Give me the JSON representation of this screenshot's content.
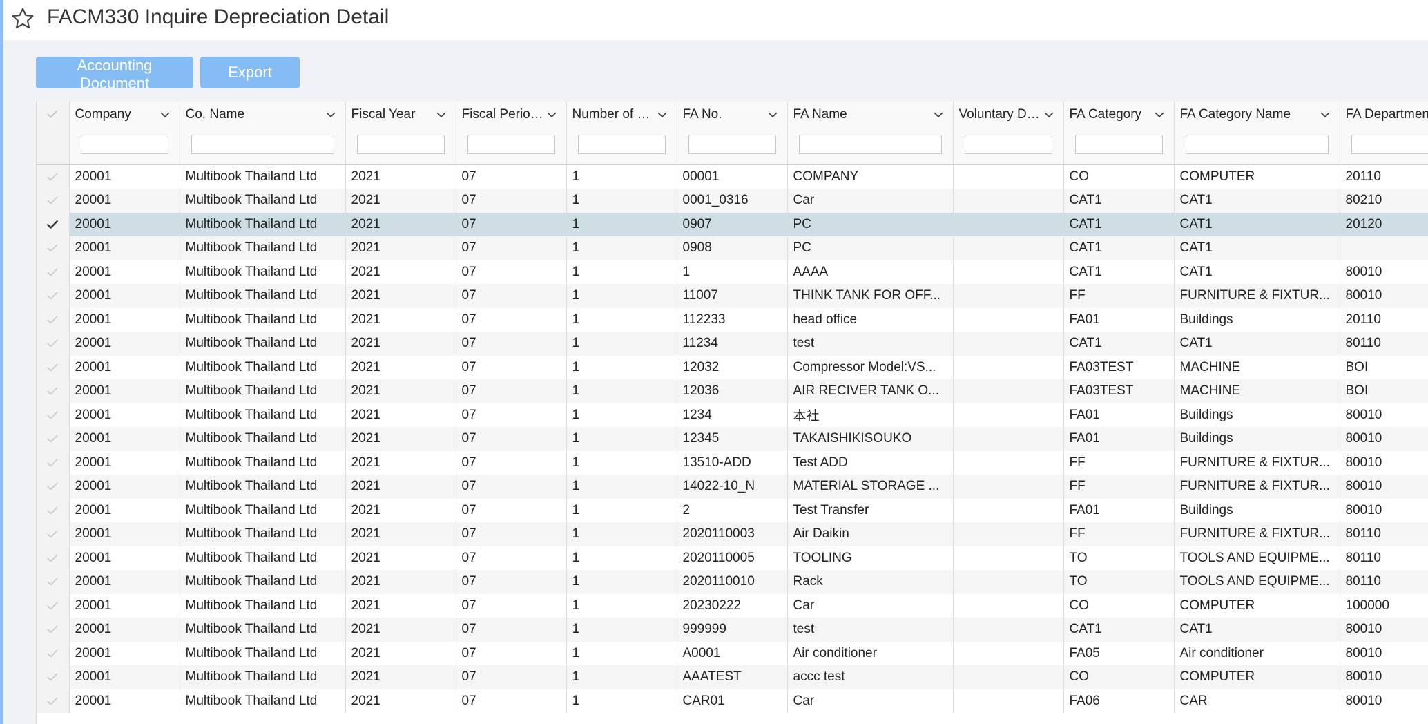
{
  "page": {
    "title": "FACM330 Inquire Depreciation Detail"
  },
  "toolbar": {
    "accounting_label": "Accounting Document",
    "export_label": "Export"
  },
  "columns": [
    "Company",
    "Co. Name",
    "Fiscal Year",
    "Fiscal Period ...",
    "Number of Ex...",
    "FA No.",
    "FA Name",
    "Voluntary Dep...",
    "FA Category",
    "FA Category Name",
    "FA Department"
  ],
  "rows": [
    [
      "20001",
      "Multibook Thailand Ltd",
      "2021",
      "07",
      "1",
      "00001",
      "COMPANY",
      "",
      "CO",
      "COMPUTER",
      "20110"
    ],
    [
      "20001",
      "Multibook Thailand Ltd",
      "2021",
      "07",
      "1",
      "0001_0316",
      "Car",
      "",
      "CAT1",
      "CAT1",
      "80210"
    ],
    [
      "20001",
      "Multibook Thailand Ltd",
      "2021",
      "07",
      "1",
      "0907",
      "PC",
      "",
      "CAT1",
      "CAT1",
      "20120"
    ],
    [
      "20001",
      "Multibook Thailand Ltd",
      "2021",
      "07",
      "1",
      "0908",
      "PC",
      "",
      "CAT1",
      "CAT1",
      ""
    ],
    [
      "20001",
      "Multibook Thailand Ltd",
      "2021",
      "07",
      "1",
      "1",
      "AAAA",
      "",
      "CAT1",
      "CAT1",
      "80010"
    ],
    [
      "20001",
      "Multibook Thailand Ltd",
      "2021",
      "07",
      "1",
      "11007",
      "THINK TANK FOR OFF...",
      "",
      "FF",
      "FURNITURE & FIXTUR...",
      "80010"
    ],
    [
      "20001",
      "Multibook Thailand Ltd",
      "2021",
      "07",
      "1",
      "112233",
      "head office",
      "",
      "FA01",
      "Buildings",
      "20110"
    ],
    [
      "20001",
      "Multibook Thailand Ltd",
      "2021",
      "07",
      "1",
      "11234",
      "test",
      "",
      "CAT1",
      "CAT1",
      "80110"
    ],
    [
      "20001",
      "Multibook Thailand Ltd",
      "2021",
      "07",
      "1",
      "12032",
      "Compressor Model:VS...",
      "",
      "FA03TEST",
      "MACHINE",
      "BOI"
    ],
    [
      "20001",
      "Multibook Thailand Ltd",
      "2021",
      "07",
      "1",
      "12036",
      "AIR RECIVER TANK O...",
      "",
      "FA03TEST",
      "MACHINE",
      "BOI"
    ],
    [
      "20001",
      "Multibook Thailand Ltd",
      "2021",
      "07",
      "1",
      "1234",
      "本社",
      "",
      "FA01",
      "Buildings",
      "80010"
    ],
    [
      "20001",
      "Multibook Thailand Ltd",
      "2021",
      "07",
      "1",
      "12345",
      "TAKAISHIKISOUKO",
      "",
      "FA01",
      "Buildings",
      "80010"
    ],
    [
      "20001",
      "Multibook Thailand Ltd",
      "2021",
      "07",
      "1",
      "13510-ADD",
      "Test ADD",
      "",
      "FF",
      "FURNITURE & FIXTUR...",
      "80010"
    ],
    [
      "20001",
      "Multibook Thailand Ltd",
      "2021",
      "07",
      "1",
      "14022-10_N",
      "MATERIAL STORAGE ...",
      "",
      "FF",
      "FURNITURE & FIXTUR...",
      "80010"
    ],
    [
      "20001",
      "Multibook Thailand Ltd",
      "2021",
      "07",
      "1",
      "2",
      "Test Transfer",
      "",
      "FA01",
      "Buildings",
      "80010"
    ],
    [
      "20001",
      "Multibook Thailand Ltd",
      "2021",
      "07",
      "1",
      "2020110003",
      "Air Daikin",
      "",
      "FF",
      "FURNITURE & FIXTUR...",
      "80110"
    ],
    [
      "20001",
      "Multibook Thailand Ltd",
      "2021",
      "07",
      "1",
      "2020110005",
      "TOOLING",
      "",
      "TO",
      "TOOLS AND EQUIPME...",
      "80110"
    ],
    [
      "20001",
      "Multibook Thailand Ltd",
      "2021",
      "07",
      "1",
      "2020110010",
      "Rack",
      "",
      "TO",
      "TOOLS AND EQUIPME...",
      "80110"
    ],
    [
      "20001",
      "Multibook Thailand Ltd",
      "2021",
      "07",
      "1",
      "20230222",
      "Car",
      "",
      "CO",
      "COMPUTER",
      "100000"
    ],
    [
      "20001",
      "Multibook Thailand Ltd",
      "2021",
      "07",
      "1",
      "999999",
      "test",
      "",
      "CAT1",
      "CAT1",
      "80010"
    ],
    [
      "20001",
      "Multibook Thailand Ltd",
      "2021",
      "07",
      "1",
      "A0001",
      "Air conditioner",
      "",
      "FA05",
      "Air conditioner",
      "80010"
    ],
    [
      "20001",
      "Multibook Thailand Ltd",
      "2021",
      "07",
      "1",
      "AAATEST",
      "accc test",
      "",
      "CO",
      "COMPUTER",
      "80010"
    ],
    [
      "20001",
      "Multibook Thailand Ltd",
      "2021",
      "07",
      "1",
      "CAR01",
      "Car",
      "",
      "FA06",
      "CAR",
      "80010"
    ]
  ],
  "selected_row": 2,
  "colors": {
    "accent": "#85bcf4",
    "selected_row": "#cfdee4",
    "left_strip": "#8fbff2"
  }
}
